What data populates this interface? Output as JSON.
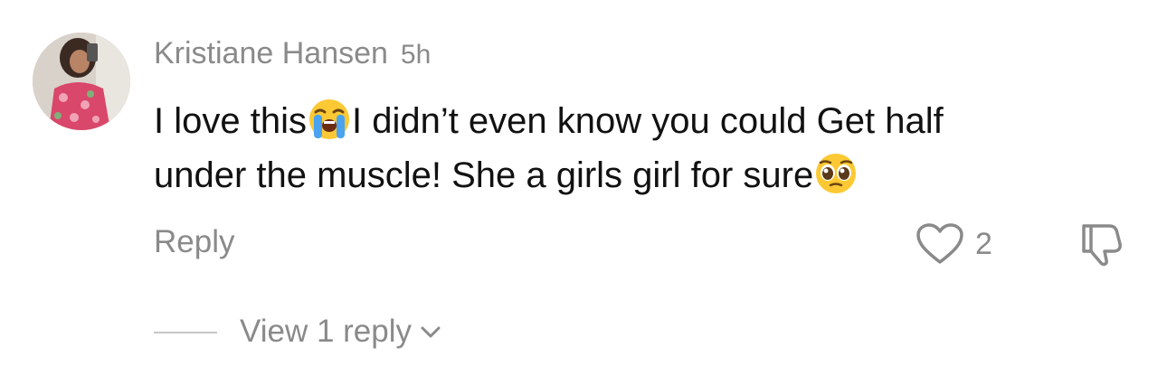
{
  "comment": {
    "author": "Kristiane Hansen",
    "timestamp": "5h",
    "text_line1_a": "I love this",
    "text_line1_b": "I didn’t even know you could Get half",
    "text_line2": "under the muscle! She a girls girl for sure",
    "emoji_1": "loudly-crying-face",
    "emoji_2": "pleading-face",
    "reply_label": "Reply",
    "like_count": "2",
    "view_replies_label": "View 1 reply"
  },
  "colors": {
    "text_primary": "#111111",
    "text_secondary": "#8a8a8a",
    "divider": "#c7c7c7",
    "background": "#ffffff"
  },
  "icons": [
    "avatar",
    "heart-outline-icon",
    "thumbs-down-icon",
    "chevron-down-icon"
  ]
}
